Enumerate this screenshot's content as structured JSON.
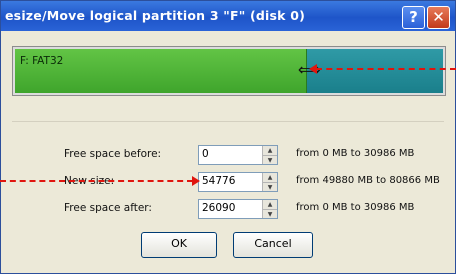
{
  "dialog": {
    "title": "esize/Move  logical partition 3  \"F\"  (disk 0)",
    "help_glyph": "?",
    "close_glyph": "✕"
  },
  "partition_bar": {
    "label": "F: FAT32",
    "handle_glyph": "⟺"
  },
  "fields": [
    {
      "label": "Free space before:",
      "value": "0",
      "range": "from 0  MB  to 30986  MB"
    },
    {
      "label": "New size:",
      "value": "54776",
      "range": "from 49880  MB  to 80866  MB"
    },
    {
      "label": "Free space after:",
      "value": "26090",
      "range": "from 0  MB  to 30986  MB"
    }
  ],
  "buttons": {
    "ok": "OK",
    "cancel": "Cancel"
  },
  "colors": {
    "partition": "#4caf38",
    "free_space": "#1f8a96",
    "annotation_arrow": "#e0150e",
    "titlebar": "#245edb"
  }
}
